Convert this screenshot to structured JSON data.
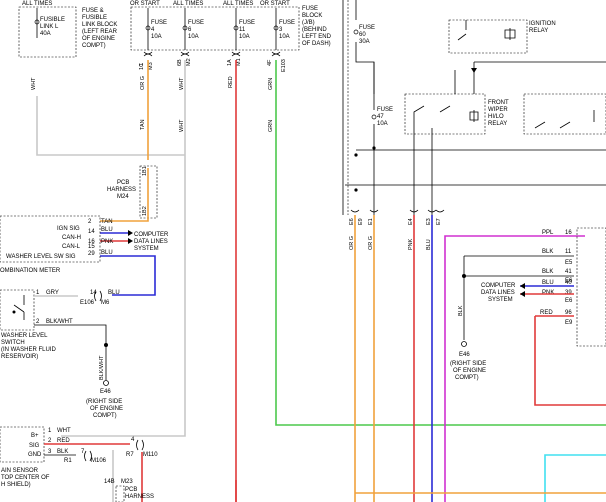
{
  "colors": {
    "wht": "#c8c8c8",
    "tan": "#f0a23c",
    "red": "#e03a3a",
    "grn": "#4cc84c",
    "blu": "#2b2bd6",
    "ppl": "#d030d0",
    "cyan": "#40e0f0",
    "blk": "#000000"
  },
  "top_labels": {
    "all_times_1": "ALL TIMES",
    "fusible_block": [
      "FUSE &",
      "FUSIBLE",
      "LINK BLOCK",
      "(LEFT REAR",
      "OF ENGINE",
      "COMPT)"
    ],
    "fusible_link": [
      "FUSIBLE",
      "LINK L",
      "40A"
    ],
    "or_start": "OR START",
    "all_times_2": "ALL TIMES",
    "all_times_3": "ALL TIMES",
    "or_start_2": "OR START",
    "fuse4": [
      "FUSE",
      "4",
      "10A"
    ],
    "fuse6": [
      "FUSE",
      "6",
      "10A"
    ],
    "fuse11": [
      "FUSE",
      "11",
      "10A"
    ],
    "fuse3": [
      "FUSE",
      "3",
      "10A"
    ],
    "fuse_block_jb": [
      "FUSE",
      "BLOCK",
      "(J/B)",
      "(BEHIND",
      "LEFT END",
      "OF DASH)"
    ]
  },
  "connectors_top": [
    "1",
    "1C",
    "M3",
    "6B",
    "M2",
    "1A",
    "M1",
    "4F",
    "E103"
  ],
  "wire_labels": {
    "wht1": "WHT",
    "org": "OR G",
    "wht2": "WHT",
    "red": "RED",
    "grn": "GRN",
    "tan": "TAN",
    "wht3": "WHT",
    "grn2": "GRN"
  },
  "pcb_harness": [
    "PCB",
    "HARNESS",
    "M24"
  ],
  "pcb_pins": [
    "1B1",
    "1B2"
  ],
  "combo_meter": {
    "pins": [
      {
        "num": "2",
        "wire": "TAN",
        "sig": ""
      },
      {
        "num": "14",
        "wire": "BLU",
        "sig": "IGN SIG"
      },
      {
        "num": "16",
        "wire": "PNK",
        "sig": "CAN-H"
      },
      {
        "num": "15",
        "wire": "",
        "sig": "CAN-L"
      },
      {
        "num": "29",
        "wire": "BLU",
        "sig": "WASHER LEVEL SW SIG"
      }
    ],
    "data_lines": [
      "COMPUTER",
      "DATA LINES",
      "SYSTEM"
    ],
    "title": "OMBINATION METER"
  },
  "washer_switch": {
    "pin1": "1",
    "pin1_wire": "GRY",
    "pin2": "2",
    "pin2_wire": "BLK/WHT",
    "conn_pin": "14",
    "conn_wire": "BLU",
    "conn_id": "E106",
    "conn_m": "M6",
    "label": [
      "WASHER LEVEL",
      "SWITCH",
      "(IN WASHER FLUID",
      "RESERVOIR)"
    ],
    "ground_wire": "BLK/WHT",
    "ground_id": "E46",
    "ground_label": [
      "(RIGHT SIDE",
      "OF ENGINE",
      "COMPT)"
    ]
  },
  "rain_sensor": {
    "pins": [
      {
        "name": "B+",
        "num": "1",
        "wire": "WHT"
      },
      {
        "name": "SIG",
        "num": "2",
        "wire": "RED"
      },
      {
        "name": "GND",
        "num": "3",
        "wire": "BLK"
      }
    ],
    "r7": "R7",
    "m110": "M110",
    "r7_pin": "4",
    "r1": "R1",
    "r1_pin": "7",
    "m106": "M106",
    "label": [
      "AIN SENSOR",
      "TOP CENTER OF",
      "H SHIELD)"
    ],
    "pcb_m23": [
      "M23",
      "PCB",
      "HARNESS"
    ],
    "pcb_pin": "14B"
  },
  "right_section": {
    "fuse60": [
      "FUSE",
      "60",
      "30A"
    ],
    "fuse47": [
      "FUSE",
      "47",
      "10A"
    ],
    "ignition_relay": [
      "IGNITION",
      "RELAY"
    ],
    "wiper_relay": [
      "FRONT",
      "WIPER",
      "HI/LO",
      "RELAY"
    ],
    "bottom_connectors": [
      "E6",
      "E9",
      "E1",
      "E4",
      "E3",
      "E7"
    ],
    "bottom_wires": [
      "OR G",
      "OR G",
      "PNK",
      "BLU",
      "BLK"
    ],
    "right_pins": [
      {
        "wire": "PPL",
        "num": "16",
        "id": ""
      },
      {
        "wire": "BLK",
        "num": "11",
        "id": "E5"
      },
      {
        "wire": "BLK",
        "num": "41",
        "id": "E6"
      },
      {
        "wire": "BLU",
        "num": "40",
        "id": ""
      },
      {
        "wire": "PNK",
        "num": "39",
        "id": "E6"
      },
      {
        "wire": "RED",
        "num": "96",
        "id": "E9"
      }
    ],
    "data_lines": [
      "COMPUTER",
      "DATA LINES",
      "SYSTEM"
    ],
    "ground_wire": "BLK",
    "ground_id": "E46",
    "ground_label": [
      "(RIGHT SIDE",
      "OF ENGINE",
      "COMPT)"
    ]
  }
}
